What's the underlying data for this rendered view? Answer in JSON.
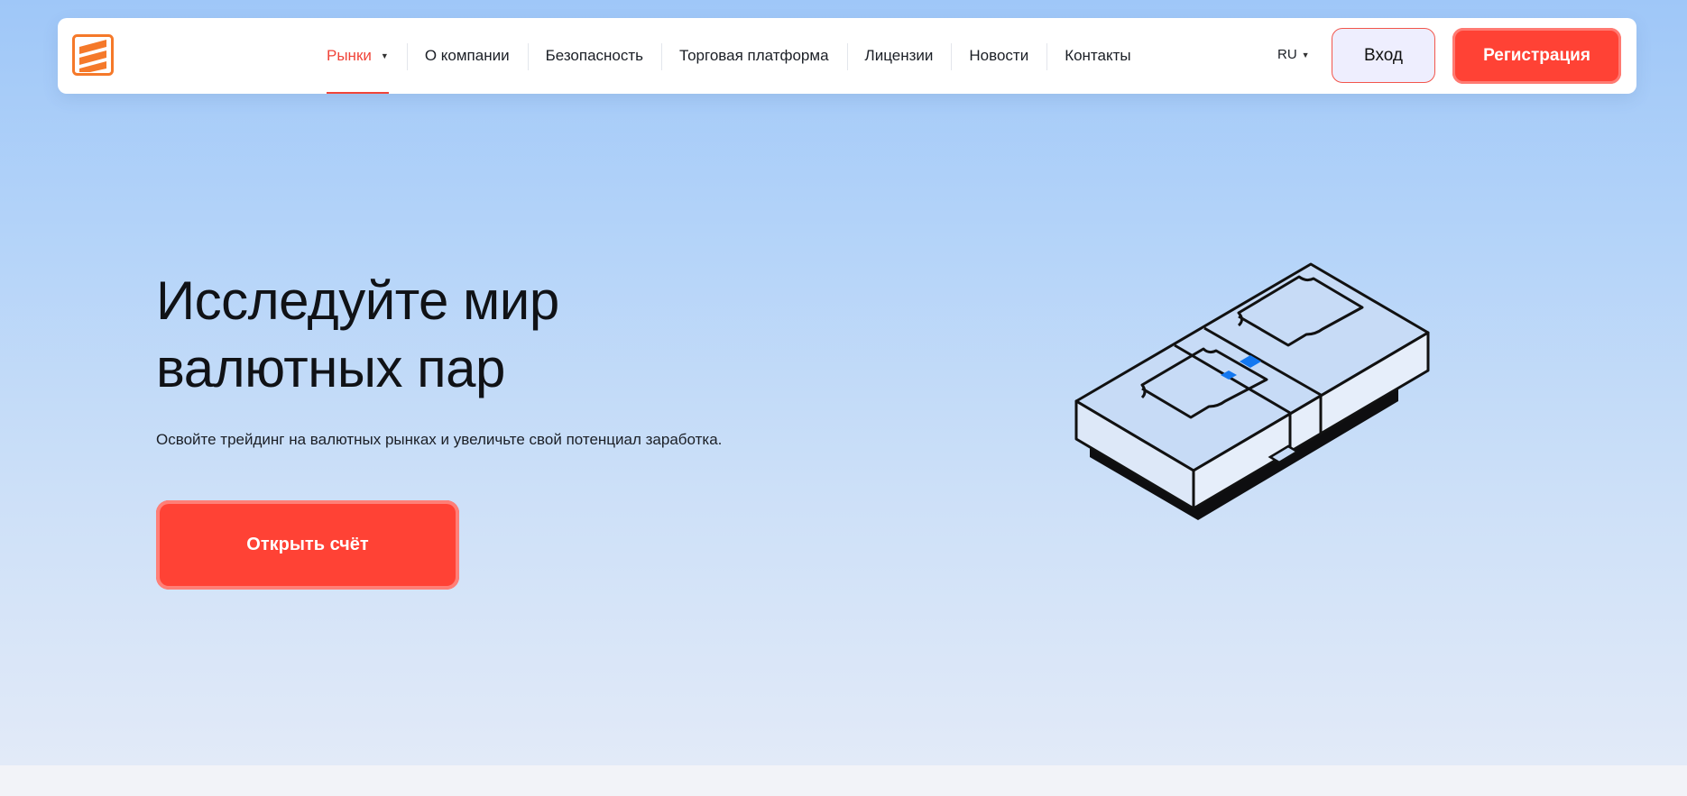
{
  "header": {
    "logo_icon": "brand-logo-icon",
    "nav": [
      {
        "label": "Рынки",
        "active": true,
        "has_dropdown": true
      },
      {
        "label": "О компании"
      },
      {
        "label": "Безопасность"
      },
      {
        "label": "Торговая платформа"
      },
      {
        "label": "Лицензии"
      },
      {
        "label": "Новости"
      },
      {
        "label": "Контакты"
      }
    ],
    "language": "RU",
    "login_label": "Вход",
    "register_label": "Регистрация"
  },
  "hero": {
    "title_line1": "Исследуйте мир",
    "title_line2": "валютных пар",
    "subtitle": "Освойте трейдинг на валютных рынках и увеличьте свой потенциал заработка.",
    "cta_label": "Открыть счёт",
    "illustration": "banknote-stack-illustration"
  },
  "colors": {
    "accent": "#ff4235",
    "accent_border": "#ff7a72",
    "active_nav": "#f0453a",
    "logo_orange": "#f5792a",
    "illustration_blue": "#1478f0"
  }
}
